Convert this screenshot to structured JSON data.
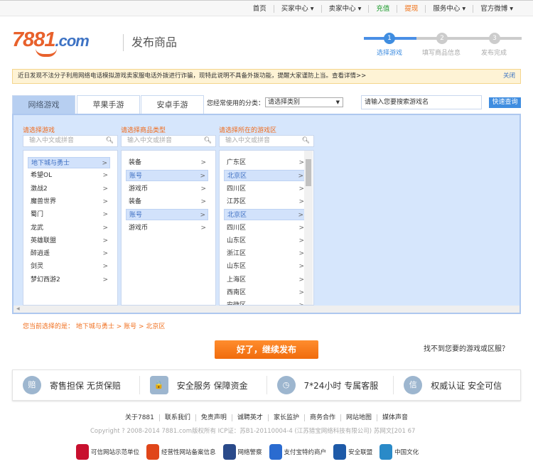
{
  "topnav": [
    "首页",
    "买家中心 ▾",
    "卖家中心 ▾",
    "充值",
    "提现",
    "服务中心 ▾",
    "官方微博 ▾"
  ],
  "logo": {
    "text": "7881.com",
    "num": "7881",
    "dom": ".com"
  },
  "page_title": "发布商品",
  "steps": [
    {
      "n": "1",
      "label": "选择游戏"
    },
    {
      "n": "2",
      "label": "填写商品信息"
    },
    {
      "n": "3",
      "label": "发布完成"
    }
  ],
  "notice": {
    "text": "近日发现不法分子利用网络电话模拟游戏卖家服电话外拨进行诈骗，现特此说明不具备外拨功能，提醒大家谨防上当。查看详情>>",
    "close": "关闭"
  },
  "tabs": [
    "网络游戏",
    "苹果手游",
    "安卓手游"
  ],
  "category": {
    "label": "您经常使用的分类：",
    "value": "请选择类别"
  },
  "search": {
    "placeholder": "请输入您要搜索游戏名",
    "button": "快速查询"
  },
  "columns": [
    {
      "title": "请选择游戏",
      "placeholder": "输入中文或拼音",
      "items": [
        "地下城与勇士",
        "希望OL",
        "激战2",
        "魔兽世界",
        "蜀门",
        "龙武",
        "英雄联盟",
        "醉逍遥",
        "剑灵",
        "梦幻西游2"
      ],
      "selected": [
        0
      ]
    },
    {
      "title": "请选择商品类型",
      "placeholder": "输入中文或拼音",
      "items": [
        "装备",
        "账号",
        "游戏币",
        "装备",
        "账号",
        "游戏币"
      ],
      "selected": [
        1,
        4
      ]
    },
    {
      "title": "请选择所在的游戏区",
      "placeholder": "输入中文或拼音",
      "items": [
        "广东区",
        "北京区",
        "四川区",
        "江苏区",
        "北京区",
        "四川区",
        "山东区",
        "浙江区",
        "山东区",
        "上海区",
        "西南区",
        "安徽区"
      ],
      "selected": [
        1,
        4
      ]
    }
  ],
  "crumb": {
    "prefix": "您当前选择的是：",
    "path": "地下城与勇士 > 账号 > 北京区"
  },
  "continue": "好了，继续发布",
  "not_found": "找不到您要的游戏或区服？",
  "features": [
    {
      "icon": "赔",
      "text": "寄售担保  无货保赔"
    },
    {
      "icon": "🔒",
      "text": "安全服务  保障资金"
    },
    {
      "icon": "◷",
      "text": "7*24小时  专属客服"
    },
    {
      "icon": "信",
      "text": "权威认证  安全可信"
    }
  ],
  "footer_links": [
    "关于7881",
    "联系我们",
    "免责声明",
    "诚聘英才",
    "家长监护",
    "商务合作",
    "网站地图",
    "媒体声音"
  ],
  "copyright": "Copyright ? 2008-2014 7881.com版权所有  ICP证：苏B1-20110004-4 (江苏猎宝网络科技有限公司)  苏网文[201     67",
  "badges": [
    "可信网站示范单位",
    "经营性网站备案信息",
    "网络警察",
    "支付宝特约商户",
    "安全联盟",
    "中国文化"
  ],
  "colors": {
    "accent": "#3f8de0",
    "orange": "#f06b0c",
    "panel": "#d6e6fc"
  }
}
